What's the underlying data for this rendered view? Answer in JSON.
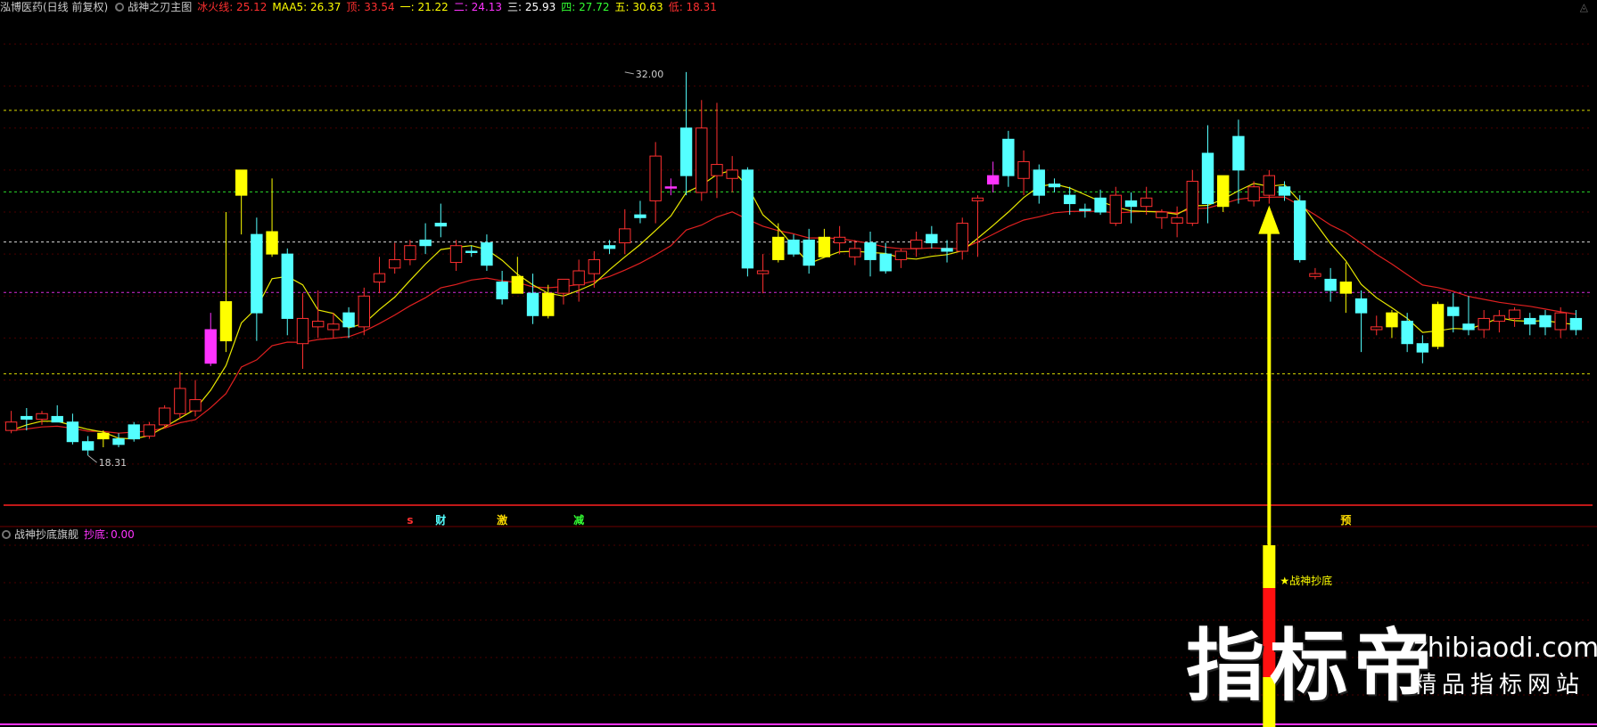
{
  "header": {
    "stock": "泓博医药(日线 前复权)",
    "indicator_name": "战神之刃主图",
    "items": [
      {
        "label": "冰火线:",
        "value": "25.12",
        "color": "#ff3030"
      },
      {
        "label": "MAA5:",
        "value": "26.37",
        "color": "#ffff00"
      },
      {
        "label": "顶:",
        "value": "33.54",
        "color": "#ff3030"
      },
      {
        "label": "一:",
        "value": "21.22",
        "color": "#ffff00"
      },
      {
        "label": "二:",
        "value": "24.13",
        "color": "#ff33ff"
      },
      {
        "label": "三:",
        "value": "25.93",
        "color": "#ffffff"
      },
      {
        "label": "四:",
        "value": "27.72",
        "color": "#33ff33"
      },
      {
        "label": "五:",
        "value": "30.63",
        "color": "#ffff00"
      },
      {
        "label": "低:",
        "value": "18.31",
        "color": "#ff3030"
      }
    ]
  },
  "sub_header": {
    "indicator_name": "战神抄底旗舰",
    "label": "抄底:",
    "value": "0.00",
    "color": "#ff33ff"
  },
  "icons": {
    "collapse": "circle-dot-icon",
    "corner": "caret-up-icon"
  },
  "watermark": {
    "big": "指标帝",
    "url": "zhibiaodi.com",
    "sub": "精品指标网站"
  },
  "colors": {
    "up": "#ff3030",
    "down": "#54ffff",
    "yellow": "#ffff00",
    "magenta": "#ff33ff",
    "ma": "#e8e800",
    "ice_fire": "#e02020"
  },
  "chart_data": {
    "type": "candlestick",
    "title": "",
    "ylim": [
      16.5,
      34.0
    ],
    "level_lines": [
      {
        "value": 30.63,
        "color": "#ffff00"
      },
      {
        "value": 27.72,
        "color": "#33ff33"
      },
      {
        "value": 25.93,
        "color": "#ffffff"
      },
      {
        "value": 24.13,
        "color": "#ff33ff"
      },
      {
        "value": 21.22,
        "color": "#ffff00"
      }
    ],
    "annotations": [
      {
        "text": "32.00",
        "index": 40,
        "value": 32.0
      },
      {
        "text": "18.31",
        "index": 5,
        "value": 18.31
      }
    ],
    "signals": [
      {
        "text": "s",
        "index": 26,
        "color": "#ff3030"
      },
      {
        "text": "财",
        "index": 28,
        "color": "#54ffff"
      },
      {
        "text": "激",
        "index": 32,
        "color": "#ffdd00"
      },
      {
        "text": "减",
        "index": 37,
        "color": "#33ff33"
      },
      {
        "text": "预",
        "index": 87,
        "color": "#ffdd00"
      }
    ],
    "buy_signal": {
      "index": 82,
      "label": "★战神抄底"
    },
    "candles": [
      {
        "o": 19.5,
        "h": 19.9,
        "l": 19.1,
        "c": 19.2,
        "k": "u"
      },
      {
        "o": 19.7,
        "h": 20.0,
        "l": 19.2,
        "c": 19.6,
        "k": "d"
      },
      {
        "o": 19.6,
        "h": 19.9,
        "l": 19.4,
        "c": 19.8,
        "k": "u"
      },
      {
        "o": 19.7,
        "h": 20.1,
        "l": 19.5,
        "c": 19.5,
        "k": "d"
      },
      {
        "o": 19.5,
        "h": 19.8,
        "l": 18.7,
        "c": 18.8,
        "k": "d"
      },
      {
        "o": 18.8,
        "h": 19.0,
        "l": 18.31,
        "c": 18.5,
        "k": "d"
      },
      {
        "o": 18.9,
        "h": 19.2,
        "l": 18.6,
        "c": 19.1,
        "k": "y"
      },
      {
        "o": 18.9,
        "h": 19.1,
        "l": 18.6,
        "c": 18.7,
        "k": "d"
      },
      {
        "o": 18.9,
        "h": 19.5,
        "l": 18.8,
        "c": 19.4,
        "k": "d"
      },
      {
        "o": 19.0,
        "h": 19.5,
        "l": 18.9,
        "c": 19.4,
        "k": "u"
      },
      {
        "o": 19.4,
        "h": 20.1,
        "l": 19.3,
        "c": 20.0,
        "k": "u"
      },
      {
        "o": 19.8,
        "h": 21.3,
        "l": 19.6,
        "c": 20.7,
        "k": "u"
      },
      {
        "o": 19.9,
        "h": 21.0,
        "l": 19.7,
        "c": 20.3,
        "k": "u"
      },
      {
        "o": 21.6,
        "h": 23.4,
        "l": 21.5,
        "c": 22.8,
        "k": "m"
      },
      {
        "o": 22.4,
        "h": 27.0,
        "l": 22.0,
        "c": 23.8,
        "k": "y"
      },
      {
        "o": 28.5,
        "h": 28.5,
        "l": 26.2,
        "c": 27.6,
        "k": "y"
      },
      {
        "o": 26.2,
        "h": 26.8,
        "l": 22.4,
        "c": 23.4,
        "k": "d"
      },
      {
        "o": 26.3,
        "h": 28.2,
        "l": 25.4,
        "c": 25.5,
        "k": "y"
      },
      {
        "o": 25.5,
        "h": 25.7,
        "l": 22.6,
        "c": 23.2,
        "k": "d"
      },
      {
        "o": 23.2,
        "h": 24.1,
        "l": 21.4,
        "c": 22.3,
        "k": "u"
      },
      {
        "o": 22.9,
        "h": 24.2,
        "l": 22.5,
        "c": 23.1,
        "k": "u"
      },
      {
        "o": 23.0,
        "h": 23.4,
        "l": 22.5,
        "c": 22.8,
        "k": "u"
      },
      {
        "o": 23.4,
        "h": 23.6,
        "l": 22.5,
        "c": 22.9,
        "k": "d"
      },
      {
        "o": 22.9,
        "h": 24.3,
        "l": 22.6,
        "c": 24.0,
        "k": "u"
      },
      {
        "o": 24.5,
        "h": 25.4,
        "l": 24.1,
        "c": 24.8,
        "k": "u"
      },
      {
        "o": 25.0,
        "h": 25.9,
        "l": 24.8,
        "c": 25.3,
        "k": "u"
      },
      {
        "o": 25.3,
        "h": 26.0,
        "l": 25.1,
        "c": 25.8,
        "k": "u"
      },
      {
        "o": 26.0,
        "h": 26.6,
        "l": 25.5,
        "c": 25.8,
        "k": "d"
      },
      {
        "o": 26.5,
        "h": 27.3,
        "l": 26.1,
        "c": 26.6,
        "k": "d"
      },
      {
        "o": 25.8,
        "h": 26.0,
        "l": 24.9,
        "c": 25.2,
        "k": "u"
      },
      {
        "o": 25.6,
        "h": 25.8,
        "l": 25.4,
        "c": 25.6,
        "k": "d"
      },
      {
        "o": 25.9,
        "h": 26.2,
        "l": 24.9,
        "c": 25.1,
        "k": "d"
      },
      {
        "o": 24.5,
        "h": 24.9,
        "l": 23.7,
        "c": 23.9,
        "k": "d"
      },
      {
        "o": 24.7,
        "h": 25.4,
        "l": 24.1,
        "c": 24.1,
        "k": "y"
      },
      {
        "o": 24.1,
        "h": 24.8,
        "l": 23.0,
        "c": 23.3,
        "k": "d"
      },
      {
        "o": 23.3,
        "h": 24.4,
        "l": 23.2,
        "c": 24.1,
        "k": "y"
      },
      {
        "o": 24.1,
        "h": 24.5,
        "l": 23.7,
        "c": 24.6,
        "k": "u"
      },
      {
        "o": 24.4,
        "h": 25.3,
        "l": 23.8,
        "c": 24.9,
        "k": "u"
      },
      {
        "o": 24.8,
        "h": 25.6,
        "l": 24.3,
        "c": 25.3,
        "k": "u"
      },
      {
        "o": 25.7,
        "h": 26.0,
        "l": 25.5,
        "c": 25.8,
        "k": "d"
      },
      {
        "o": 25.9,
        "h": 27.1,
        "l": 25.5,
        "c": 26.4,
        "k": "u"
      },
      {
        "o": 26.9,
        "h": 27.4,
        "l": 26.6,
        "c": 26.8,
        "k": "d"
      },
      {
        "o": 29.0,
        "h": 29.5,
        "l": 26.6,
        "c": 27.4,
        "k": "u"
      },
      {
        "o": 27.9,
        "h": 28.2,
        "l": 27.6,
        "c": 27.9,
        "k": "m"
      },
      {
        "o": 28.3,
        "h": 32.0,
        "l": 27.6,
        "c": 30.0,
        "k": "d"
      },
      {
        "o": 30.0,
        "h": 31.0,
        "l": 27.4,
        "c": 27.7,
        "k": "u"
      },
      {
        "o": 28.3,
        "h": 30.9,
        "l": 27.5,
        "c": 28.7,
        "k": "u"
      },
      {
        "o": 28.5,
        "h": 29.0,
        "l": 27.7,
        "c": 28.2,
        "k": "u"
      },
      {
        "o": 28.5,
        "h": 28.6,
        "l": 24.7,
        "c": 25.0,
        "k": "d"
      },
      {
        "o": 24.8,
        "h": 25.5,
        "l": 24.1,
        "c": 24.9,
        "k": "u"
      },
      {
        "o": 26.1,
        "h": 26.6,
        "l": 25.2,
        "c": 25.3,
        "k": "y"
      },
      {
        "o": 26.0,
        "h": 26.2,
        "l": 25.4,
        "c": 25.5,
        "k": "d"
      },
      {
        "o": 26.0,
        "h": 26.4,
        "l": 24.8,
        "c": 25.1,
        "k": "d"
      },
      {
        "o": 25.4,
        "h": 26.4,
        "l": 25.5,
        "c": 26.1,
        "k": "y"
      },
      {
        "o": 26.1,
        "h": 26.5,
        "l": 25.5,
        "c": 25.9,
        "k": "u"
      },
      {
        "o": 25.7,
        "h": 26.0,
        "l": 25.1,
        "c": 25.4,
        "k": "u"
      },
      {
        "o": 25.9,
        "h": 26.3,
        "l": 24.7,
        "c": 25.3,
        "k": "d"
      },
      {
        "o": 25.5,
        "h": 25.9,
        "l": 24.8,
        "c": 24.9,
        "k": "d"
      },
      {
        "o": 25.6,
        "h": 25.7,
        "l": 25.0,
        "c": 25.3,
        "k": "u"
      },
      {
        "o": 26.0,
        "h": 26.3,
        "l": 25.4,
        "c": 25.7,
        "k": "u"
      },
      {
        "o": 26.2,
        "h": 26.5,
        "l": 25.7,
        "c": 25.9,
        "k": "d"
      },
      {
        "o": 25.7,
        "h": 26.0,
        "l": 25.2,
        "c": 25.6,
        "k": "d"
      },
      {
        "o": 26.6,
        "h": 26.8,
        "l": 25.3,
        "c": 25.6,
        "k": "u"
      },
      {
        "o": 27.4,
        "h": 27.6,
        "l": 25.4,
        "c": 27.5,
        "k": "u"
      },
      {
        "o": 28.3,
        "h": 28.8,
        "l": 27.7,
        "c": 28.0,
        "k": "m"
      },
      {
        "o": 29.6,
        "h": 29.9,
        "l": 27.9,
        "c": 28.3,
        "k": "d"
      },
      {
        "o": 28.8,
        "h": 29.2,
        "l": 27.6,
        "c": 28.2,
        "k": "u"
      },
      {
        "o": 28.5,
        "h": 28.7,
        "l": 27.3,
        "c": 27.6,
        "k": "d"
      },
      {
        "o": 28.0,
        "h": 28.2,
        "l": 27.7,
        "c": 27.9,
        "k": "d"
      },
      {
        "o": 27.6,
        "h": 27.9,
        "l": 26.9,
        "c": 27.3,
        "k": "d"
      },
      {
        "o": 27.1,
        "h": 27.3,
        "l": 26.8,
        "c": 27.1,
        "k": "d"
      },
      {
        "o": 27.5,
        "h": 27.8,
        "l": 26.9,
        "c": 27.0,
        "k": "d"
      },
      {
        "o": 27.6,
        "h": 27.9,
        "l": 26.5,
        "c": 26.6,
        "k": "u"
      },
      {
        "o": 27.4,
        "h": 27.7,
        "l": 26.6,
        "c": 27.2,
        "k": "d"
      },
      {
        "o": 27.5,
        "h": 27.9,
        "l": 26.9,
        "c": 27.2,
        "k": "u"
      },
      {
        "o": 26.8,
        "h": 27.1,
        "l": 26.4,
        "c": 27.0,
        "k": "u"
      },
      {
        "o": 26.8,
        "h": 27.2,
        "l": 26.1,
        "c": 26.6,
        "k": "u"
      },
      {
        "o": 26.6,
        "h": 28.5,
        "l": 26.5,
        "c": 28.1,
        "k": "u"
      },
      {
        "o": 29.1,
        "h": 30.1,
        "l": 26.6,
        "c": 27.3,
        "k": "d"
      },
      {
        "o": 27.2,
        "h": 28.2,
        "l": 27.0,
        "c": 28.3,
        "k": "y"
      },
      {
        "o": 29.7,
        "h": 30.3,
        "l": 27.3,
        "c": 28.5,
        "k": "d"
      },
      {
        "o": 27.4,
        "h": 28.1,
        "l": 27.2,
        "c": 27.9,
        "k": "u"
      },
      {
        "o": 28.3,
        "h": 28.5,
        "l": 27.3,
        "c": 27.6,
        "k": "u"
      },
      {
        "o": 27.9,
        "h": 28.1,
        "l": 27.4,
        "c": 27.6,
        "k": "d"
      },
      {
        "o": 27.4,
        "h": 27.6,
        "l": 25.2,
        "c": 25.3,
        "k": "d"
      },
      {
        "o": 24.8,
        "h": 25.0,
        "l": 24.6,
        "c": 24.7,
        "k": "u"
      },
      {
        "o": 24.6,
        "h": 25.0,
        "l": 23.8,
        "c": 24.2,
        "k": "d"
      },
      {
        "o": 24.1,
        "h": 25.2,
        "l": 23.4,
        "c": 24.5,
        "k": "y"
      },
      {
        "o": 23.9,
        "h": 24.2,
        "l": 22.0,
        "c": 23.4,
        "k": "d"
      },
      {
        "o": 22.8,
        "h": 23.3,
        "l": 22.6,
        "c": 22.9,
        "k": "u"
      },
      {
        "o": 23.4,
        "h": 23.5,
        "l": 22.5,
        "c": 22.9,
        "k": "y"
      },
      {
        "o": 23.1,
        "h": 23.4,
        "l": 22.0,
        "c": 22.3,
        "k": "d"
      },
      {
        "o": 22.3,
        "h": 22.6,
        "l": 21.6,
        "c": 22.0,
        "k": "d"
      },
      {
        "o": 22.2,
        "h": 23.8,
        "l": 22.1,
        "c": 23.7,
        "k": "y"
      },
      {
        "o": 23.6,
        "h": 24.1,
        "l": 22.7,
        "c": 23.3,
        "k": "d"
      },
      {
        "o": 23.0,
        "h": 24.0,
        "l": 22.6,
        "c": 22.8,
        "k": "d"
      },
      {
        "o": 22.8,
        "h": 23.5,
        "l": 22.5,
        "c": 23.2,
        "k": "u"
      },
      {
        "o": 23.3,
        "h": 23.5,
        "l": 22.7,
        "c": 23.1,
        "k": "u"
      },
      {
        "o": 23.5,
        "h": 23.6,
        "l": 22.9,
        "c": 23.2,
        "k": "u"
      },
      {
        "o": 23.0,
        "h": 23.4,
        "l": 22.6,
        "c": 23.2,
        "k": "d"
      },
      {
        "o": 23.3,
        "h": 23.5,
        "l": 22.6,
        "c": 22.9,
        "k": "d"
      },
      {
        "o": 23.4,
        "h": 23.6,
        "l": 22.5,
        "c": 22.8,
        "k": "u"
      },
      {
        "o": 23.2,
        "h": 23.5,
        "l": 22.6,
        "c": 22.8,
        "k": "d"
      }
    ]
  }
}
